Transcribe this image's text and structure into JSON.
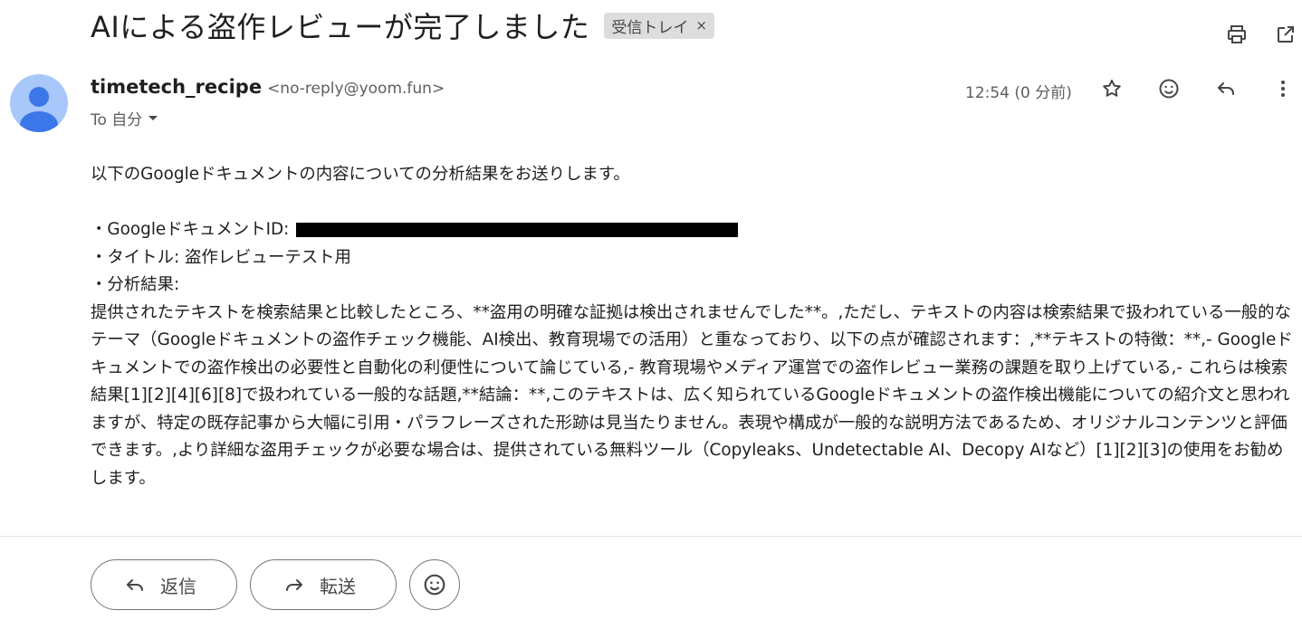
{
  "subject": "AIによる盗作レビューが完了しました",
  "label_chip": {
    "text": "受信トレイ",
    "close": "×"
  },
  "sender": {
    "name": "timetech_recipe",
    "email": "<no-reply@yoom.fun>",
    "to": "To 自分",
    "time": "12:54 (0 分前)"
  },
  "icons": {
    "print": "print-icon",
    "open_new": "open-in-new-window-icon",
    "star": "star-icon",
    "emoji": "emoji-icon",
    "reply": "reply-icon",
    "more": "more-vert-icon",
    "forward": "forward-icon",
    "caret": "caret-down-icon"
  },
  "body": {
    "intro": "以下のGoogleドキュメントの内容についての分析結果をお送りします。",
    "doc_id_label": "・GoogleドキュメントID:",
    "title_line": "・タイトル: 盗作レビューテスト用",
    "result_label": "・分析結果:",
    "analysis": "提供されたテキストを検索結果と比較したところ、**盗用の明確な証拠は検出されませんでした**。,ただし、テキストの内容は検索結果で扱われている一般的なテーマ（Googleドキュメントの盗作チェック機能、AI検出、教育現場での活用）と重なっており、以下の点が確認されます：,**テキストの特徴：**,- Googleドキュメントでの盗作検出の必要性と自動化の利便性について論じている,- 教育現場やメディア運営での盗作レビュー業務の課題を取り上げている,- これらは検索結果[1][2][4][6][8]で扱われている一般的な話題,**結論：**,このテキストは、広く知られているGoogleドキュメントの盗作検出機能についての紹介文と思われますが、特定の既存記事から大幅に引用・パラフレーズされた形跡は見当たりません。表現や構成が一般的な説明方法であるため、オリジナルコンテンツと評価できます。,より詳細な盗用チェックが必要な場合は、提供されている無料ツール（Copyleaks、Undetectable AI、Decopy AIなど）[1][2][3]の使用をお勧めします。"
  },
  "actions": {
    "reply": "返信",
    "forward": "転送"
  },
  "colors": {
    "avatar_bg": "#a8c7fa",
    "avatar_fg": "#3b77e8",
    "chip_bg": "#dddddd"
  }
}
